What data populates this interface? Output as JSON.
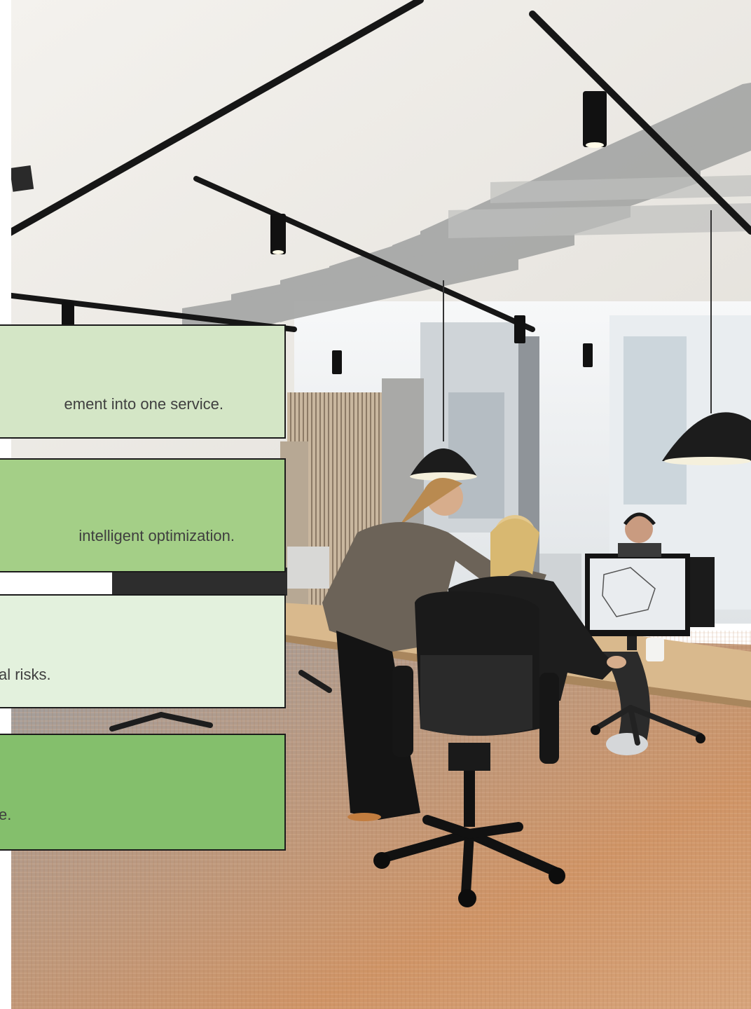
{
  "cards": [
    {
      "text": "ement into one service.",
      "color": "#d4e6c6"
    },
    {
      "text": "intelligent optimization.",
      "color": "#a4cf87"
    },
    {
      "text": "al risks.",
      "color": "#e3f1dd"
    },
    {
      "text": "e.",
      "color": "#84bf6c"
    }
  ],
  "colors": {
    "border": "#1b1b1b",
    "text": "#3f3f3f",
    "carpet": "#c68a5f",
    "ceiling": "#ece9e3"
  }
}
